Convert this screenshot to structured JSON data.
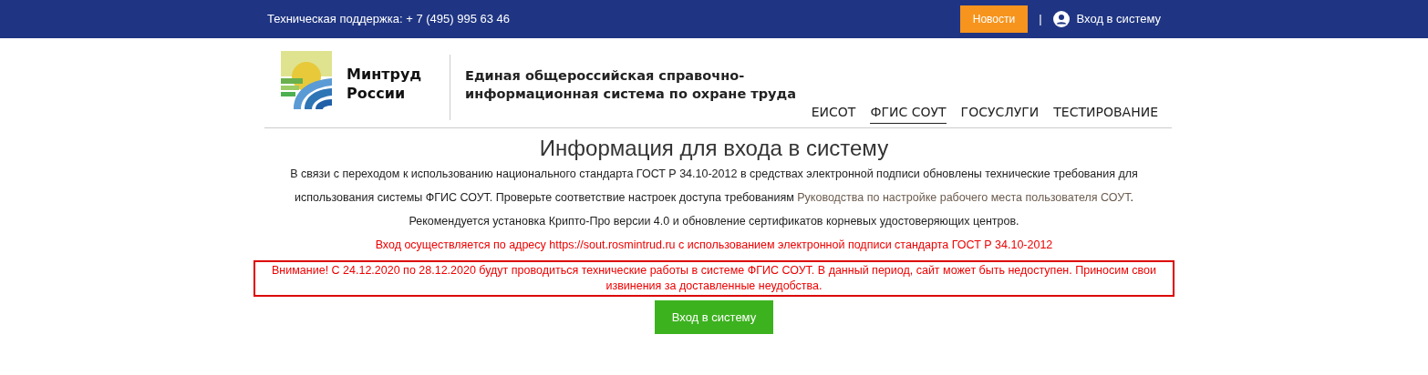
{
  "top_bar": {
    "support": "Техническая поддержка: + 7 (495) 995 63 46",
    "news_button": "Новости",
    "separator": "|",
    "login_link": "Вход в систему"
  },
  "header": {
    "org_name": "Минтруд России",
    "system_title": "Единая общероссийская справочно-информационная система по охране труда",
    "nav": [
      {
        "label": "ЕИСОТ",
        "selected": false
      },
      {
        "label": "ФГИС СОУТ",
        "selected": true
      },
      {
        "label": "ГОСУСЛУГИ",
        "selected": false
      },
      {
        "label": "ТЕСТИРОВАНИЕ",
        "selected": false
      }
    ]
  },
  "content": {
    "title": "Информация для входа в систему",
    "paragraph": {
      "text": "В связи с переходом к использованию национального стандарта ГОСТ Р 34.10-2012 в средствах электронной подписи обновлены технические требования для использования системы ФГИС СОУТ. Проверьте соответствие настроек доступа требованиям",
      "link": "Руководства по настройке рабочего места пользователя СОУТ",
      "end": "."
    },
    "recommendation": "Рекомендуется установка Крипто-Про версии 4.0 и обновление сертификатов корневых удостоверяющих центров.",
    "address_note": "Вход осуществляется по адресу https://sout.rosmintrud.ru с использованием электронной подписи стандарта ГОСТ Р 34.10-2012",
    "warning": "Внимание! С 24.12.2020 по 28.12.2020 будут проводиться технические работы в системе ФГИС СОУТ. В данный период, сайт может быть недоступен. Приносим свои извинения за доставленные неудобства.",
    "login_button": "Вход в систему"
  }
}
